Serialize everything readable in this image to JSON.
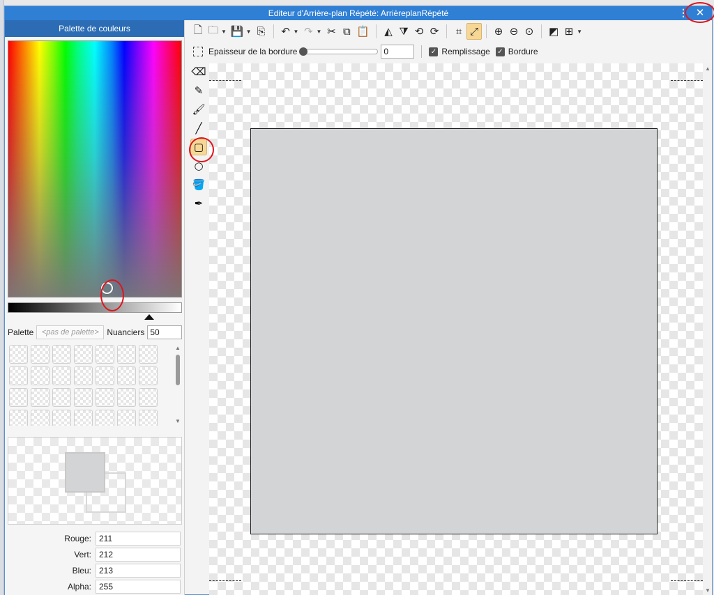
{
  "window": {
    "title": "Editeur d'Arrière-plan Répété: ArrièreplanRépété",
    "menu_icon": "vertical-dots-icon",
    "close_icon": "close-icon"
  },
  "palette_panel": {
    "header": "Palette de couleurs",
    "palette_label": "Palette",
    "palette_value": "<pas de palette>",
    "shades_label": "Nuanciers",
    "shades_value": "50",
    "swatch_count": 28,
    "rgba": [
      {
        "label": "Rouge:",
        "value": "211"
      },
      {
        "label": "Vert:",
        "value": "212"
      },
      {
        "label": "Bleu:",
        "value": "213"
      },
      {
        "label": "Alpha:",
        "value": "255"
      }
    ]
  },
  "toolbar": {
    "items": [
      {
        "icon": "new-file-icon",
        "glyph": "🗋"
      },
      {
        "icon": "open-folder-icon",
        "glyph": "🗀",
        "caret": true
      },
      {
        "icon": "save-icon",
        "glyph": "💾",
        "caret": true
      },
      {
        "icon": "export-icon",
        "glyph": "⎘"
      },
      {
        "sep": true
      },
      {
        "icon": "undo-icon",
        "glyph": "↶",
        "caret": true
      },
      {
        "icon": "redo-icon",
        "glyph": "↷",
        "caret": true,
        "disabled": true
      },
      {
        "icon": "cut-icon",
        "glyph": "✂"
      },
      {
        "icon": "copy-icon",
        "glyph": "⧉"
      },
      {
        "icon": "paste-icon",
        "glyph": "📋"
      },
      {
        "sep": true
      },
      {
        "icon": "flip-horizontal-icon",
        "glyph": "◭"
      },
      {
        "icon": "flip-vertical-icon",
        "glyph": "⧩"
      },
      {
        "icon": "rotate-left-icon",
        "glyph": "⟲"
      },
      {
        "icon": "rotate-right-icon",
        "glyph": "⟳"
      },
      {
        "sep": true
      },
      {
        "icon": "crop-icon",
        "glyph": "⌗"
      },
      {
        "icon": "resize-icon",
        "glyph": "⤢",
        "active": true
      },
      {
        "sep": true
      },
      {
        "icon": "zoom-in-icon",
        "glyph": "⊕"
      },
      {
        "icon": "zoom-out-icon",
        "glyph": "⊖"
      },
      {
        "icon": "zoom-reset-icon",
        "glyph": "⊙"
      },
      {
        "sep": true
      },
      {
        "icon": "background-color-icon",
        "glyph": "◩"
      },
      {
        "icon": "grid-icon",
        "glyph": "⊞",
        "caret": true
      }
    ]
  },
  "options_bar": {
    "selection_icon": "selection-icon",
    "border_thickness_label": "Epaisseur de la bordure",
    "border_thickness_value": "0",
    "fill_label": "Remplissage",
    "fill_checked": true,
    "border_label": "Bordure",
    "border_checked": true
  },
  "tools": [
    {
      "icon": "eraser-icon",
      "glyph": "⌫"
    },
    {
      "icon": "pencil-icon",
      "glyph": "✎"
    },
    {
      "icon": "brush-icon",
      "glyph": "🖌"
    },
    {
      "icon": "line-icon",
      "glyph": "╱"
    },
    {
      "icon": "rectangle-icon",
      "glyph": "▢",
      "active": true
    },
    {
      "icon": "ellipse-icon",
      "glyph": "○"
    },
    {
      "icon": "fill-bucket-icon",
      "glyph": "🪣"
    },
    {
      "icon": "eyedropper-icon",
      "glyph": "✒"
    }
  ],
  "colors": {
    "titlebar": "#2f7fd4",
    "palette_header": "#2b6cb5",
    "active_tool": "#f7d795",
    "drawn_fill": "#d3d4d5",
    "annotation": "#e0141e"
  }
}
